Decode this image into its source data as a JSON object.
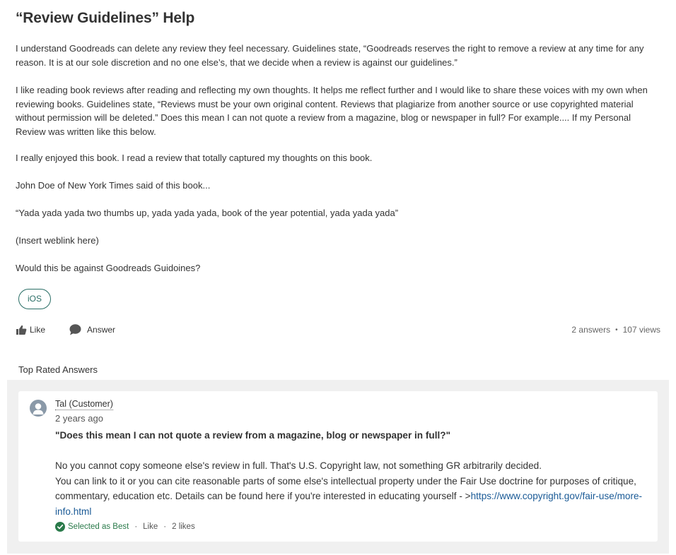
{
  "question": {
    "title": "“Review Guidelines” Help",
    "paragraphs": [
      "I understand Goodreads can delete any review they feel necessary. Guidelines state, “Goodreads reserves the right to remove a review at any time for any reason. It is at our sole discretion and no one else’s, that we decide when a review is against our guidelines.”",
      "I like reading book reviews after reading and reflecting my own thoughts. It helps me reflect further and I would like to share these voices with my own when reviewing books. Guidelines state, “Reviews must be your own original content. Reviews that plagiarize from another source or use copyrighted material without permission will be deleted.” Does this mean I can not quote a review from a magazine, blog or newspaper in full? For example.... If my Personal Review was written like this below.",
      "I really enjoyed this book. I read a review that totally captured my thoughts on this book.",
      "John Doe of New York Times said of this book...",
      "“Yada yada yada two thumbs up, yada yada yada, book of the year potential, yada yada yada”",
      "(Insert weblink here)",
      "Would this be against Goodreads Guidoines?"
    ],
    "tag": "iOS",
    "like_label": "Like",
    "answer_label": "Answer",
    "answers_count": "2 answers",
    "views_count": "107 views"
  },
  "top_answers": {
    "heading": "Top Rated Answers",
    "answer": {
      "author": "Tal (Customer)",
      "time": "2 years ago",
      "quote": "\"Does this mean I can not quote a review from a magazine, blog or newspaper in full?\"",
      "line1": "No you cannot copy someone else's review in full. That's U.S. Copyright law, not something GR arbitrarily decided.",
      "line2": "You can link to it or you can cite reasonable parts of some else's intellectual property under the Fair Use doctrine for purposes of critique, commentary, education etc. Details can be found here if you're interested in educating yourself - >",
      "link": "https://www.copyright.gov/fair-use/more-info.html",
      "selected_label": "Selected as Best",
      "like_label": "Like",
      "likes_count": "2 likes"
    }
  },
  "colors": {
    "accent": "#2a6e66",
    "link": "#1a5a96",
    "best": "#2a7a4a",
    "panel": "#f0f0f0"
  },
  "icons": {
    "like": "thumbs-up-icon",
    "answer": "speech-bubble-icon",
    "avatar": "user-avatar-icon",
    "best": "check-circle-icon"
  }
}
